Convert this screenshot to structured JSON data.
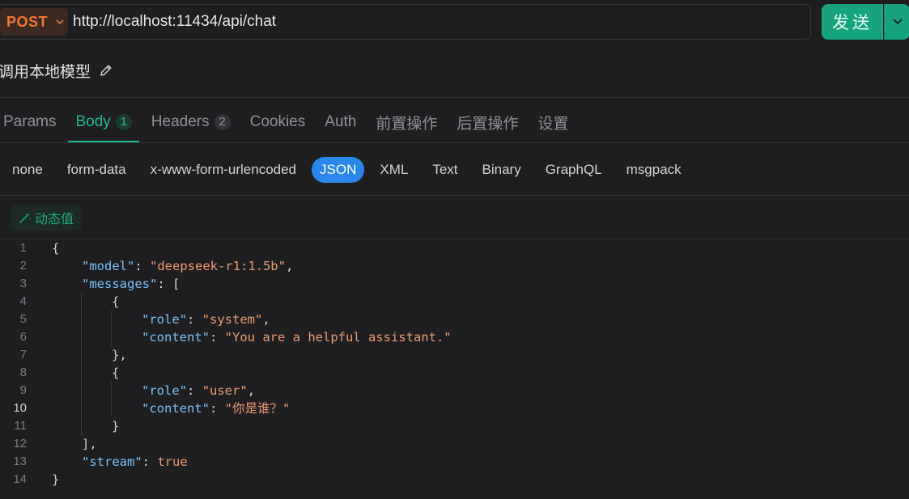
{
  "request": {
    "method": "POST",
    "url": "http://localhost:11434/api/chat",
    "send_label": "发送",
    "title": "调用本地模型"
  },
  "tabs": [
    {
      "label": "Params",
      "badge": ""
    },
    {
      "label": "Body",
      "badge": "1"
    },
    {
      "label": "Headers",
      "badge": "2"
    },
    {
      "label": "Cookies",
      "badge": ""
    },
    {
      "label": "Auth",
      "badge": ""
    },
    {
      "label": "前置操作",
      "badge": ""
    },
    {
      "label": "后置操作",
      "badge": ""
    },
    {
      "label": "设置",
      "badge": ""
    }
  ],
  "active_tab": "Body",
  "body_types": [
    "none",
    "form-data",
    "x-www-form-urlencoded",
    "JSON",
    "XML",
    "Text",
    "Binary",
    "GraphQL",
    "msgpack"
  ],
  "active_body_type": "JSON",
  "dynamic_value_label": "动态值",
  "editor": {
    "current_line": 10,
    "lines": [
      {
        "n": "1",
        "indent": 0,
        "tokens": [
          {
            "t": "{",
            "c": "p"
          }
        ]
      },
      {
        "n": "2",
        "indent": 1,
        "tokens": [
          {
            "t": "\"model\"",
            "c": "k"
          },
          {
            "t": ": ",
            "c": "p"
          },
          {
            "t": "\"deepseek-r1:1.5b\"",
            "c": "s"
          },
          {
            "t": ",",
            "c": "p"
          }
        ]
      },
      {
        "n": "3",
        "indent": 1,
        "tokens": [
          {
            "t": "\"messages\"",
            "c": "k"
          },
          {
            "t": ": [",
            "c": "p"
          }
        ]
      },
      {
        "n": "4",
        "indent": 2,
        "tokens": [
          {
            "t": "{",
            "c": "p"
          }
        ]
      },
      {
        "n": "5",
        "indent": 3,
        "tokens": [
          {
            "t": "\"role\"",
            "c": "k"
          },
          {
            "t": ": ",
            "c": "p"
          },
          {
            "t": "\"system\"",
            "c": "s"
          },
          {
            "t": ",",
            "c": "p"
          }
        ]
      },
      {
        "n": "6",
        "indent": 3,
        "tokens": [
          {
            "t": "\"content\"",
            "c": "k"
          },
          {
            "t": ": ",
            "c": "p"
          },
          {
            "t": "\"You are a helpful assistant.\"",
            "c": "s"
          }
        ]
      },
      {
        "n": "7",
        "indent": 2,
        "tokens": [
          {
            "t": "},",
            "c": "p"
          }
        ]
      },
      {
        "n": "8",
        "indent": 2,
        "tokens": [
          {
            "t": "{",
            "c": "p"
          }
        ]
      },
      {
        "n": "9",
        "indent": 3,
        "tokens": [
          {
            "t": "\"role\"",
            "c": "k"
          },
          {
            "t": ": ",
            "c": "p"
          },
          {
            "t": "\"user\"",
            "c": "s"
          },
          {
            "t": ",",
            "c": "p"
          }
        ]
      },
      {
        "n": "10",
        "indent": 3,
        "tokens": [
          {
            "t": "\"content\"",
            "c": "k"
          },
          {
            "t": ": ",
            "c": "p"
          },
          {
            "t": "\"你是谁？\"",
            "c": "s"
          }
        ]
      },
      {
        "n": "11",
        "indent": 2,
        "tokens": [
          {
            "t": "}",
            "c": "p"
          }
        ]
      },
      {
        "n": "12",
        "indent": 1,
        "tokens": [
          {
            "t": "],",
            "c": "p"
          }
        ]
      },
      {
        "n": "13",
        "indent": 1,
        "tokens": [
          {
            "t": "\"stream\"",
            "c": "k"
          },
          {
            "t": ": ",
            "c": "p"
          },
          {
            "t": "true",
            "c": "b"
          }
        ]
      },
      {
        "n": "14",
        "indent": 0,
        "tokens": [
          {
            "t": "}",
            "c": "p"
          }
        ]
      }
    ]
  },
  "colors": {
    "accent": "#17a37d",
    "method": "#f0752f",
    "active_pill": "#2b86ea",
    "json_key": "#79c0f2",
    "json_string": "#e99a6f"
  },
  "icons": [
    "chevron-down-icon",
    "edit-pencil-icon",
    "magic-wand-icon"
  ]
}
